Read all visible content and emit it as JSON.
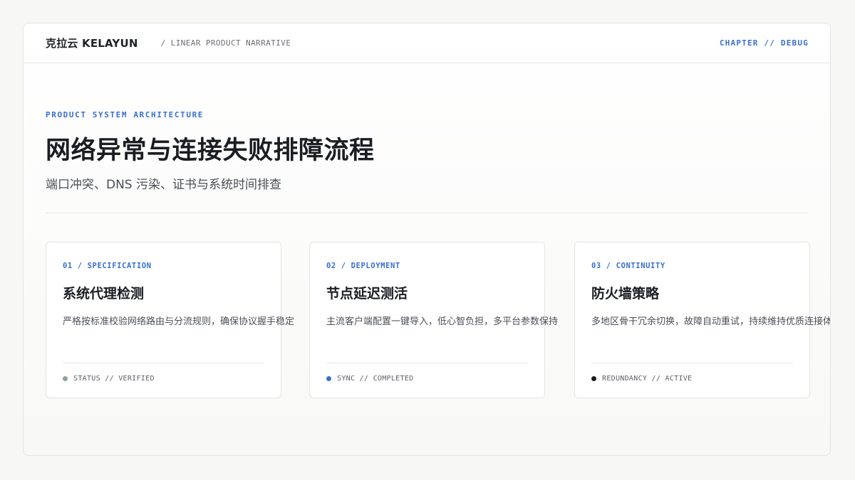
{
  "header": {
    "brand": "克拉云 KELAYUN",
    "narrative": "/ LINEAR PRODUCT NARRATIVE",
    "chapter": "CHAPTER // DEBUG"
  },
  "hero": {
    "kicker": "PRODUCT SYSTEM ARCHITECTURE",
    "title": "网络异常与连接失败排障流程",
    "subtitle": "端口冲突、DNS 污染、证书与系统时间排查"
  },
  "cards": [
    {
      "label": "01 / SPECIFICATION",
      "title": "系统代理检测",
      "desc": "严格按标准校验网络路由与分流规则，确保协议握手稳定",
      "status": "STATUS // VERIFIED",
      "dot_color": "#8aa393"
    },
    {
      "label": "02 / DEPLOYMENT",
      "title": "节点延迟测活",
      "desc": "主流客户端配置一键导入，低心智负担，多平台参数保持",
      "status": "SYNC // COMPLETED",
      "dot_color": "#3a6fd1"
    },
    {
      "label": "03 / CONTINUITY",
      "title": "防火墙策略",
      "desc": "多地区骨干冗余切换，故障自动重试，持续维持优质连接体验",
      "status": "REDUNDANCY // ACTIVE",
      "dot_color": "#1a1d22"
    }
  ]
}
